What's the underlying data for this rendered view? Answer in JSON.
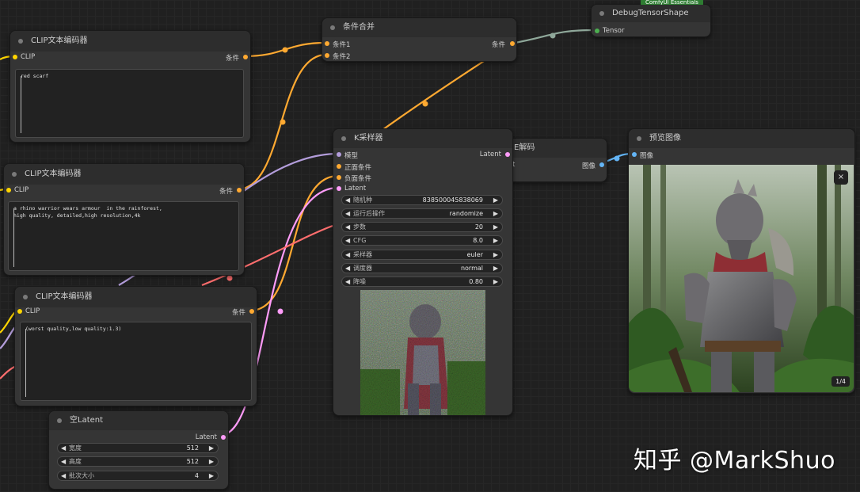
{
  "colors": {
    "clip": "#ffd500",
    "conditioning": "#ffa931",
    "model": "#b39ddb",
    "latent": "#ff9cf9",
    "image": "#64b5f6",
    "tensor": "#4caf50",
    "vae": "#ff6e6e"
  },
  "clip_node_1": {
    "title": "CLIP文本编码器",
    "in": "CLIP",
    "out": "条件",
    "text": "red scarf"
  },
  "clip_node_2": {
    "title": "CLIP文本编码器",
    "in": "CLIP",
    "out": "条件",
    "text": "a rhino warrior wears armour  in the rainforest,\nhigh quality, detailed,high resolution,4k"
  },
  "clip_node_3": {
    "title": "CLIP文本编码器",
    "in": "CLIP",
    "out": "条件",
    "text": "(worst quality,low quality:1.3)"
  },
  "combine_node": {
    "title": "条件合并",
    "in1": "条件1",
    "in2": "条件2",
    "out": "条件"
  },
  "debug_node": {
    "title": "DebugTensorShape",
    "in": "Tensor",
    "badge": "ComfyUI Essentials"
  },
  "ksampler": {
    "title": "K采样器",
    "inputs": [
      "模型",
      "正面条件",
      "负面条件",
      "Latent"
    ],
    "out": "Latent",
    "widgets": [
      {
        "label": "随机种",
        "value": "838500045838069"
      },
      {
        "label": "运行后操作",
        "value": "randomize"
      },
      {
        "label": "步数",
        "value": "20"
      },
      {
        "label": "CFG",
        "value": "8.0"
      },
      {
        "label": "采样器",
        "value": "euler"
      },
      {
        "label": "调度器",
        "value": "normal"
      },
      {
        "label": "降噪",
        "value": "0.80"
      }
    ]
  },
  "vae_node": {
    "title_partial": "E解码",
    "in_partial": "t",
    "out": "图像"
  },
  "preview_node": {
    "title": "预览图像",
    "in": "图像",
    "close": "×",
    "counter": "1/4"
  },
  "latent_node": {
    "title": "空Latent",
    "out": "Latent",
    "widgets": [
      {
        "label": "宽度",
        "value": "512"
      },
      {
        "label": "高度",
        "value": "512"
      },
      {
        "label": "批次大小",
        "value": "4"
      }
    ]
  },
  "watermark": "知乎 @MarkShuo"
}
